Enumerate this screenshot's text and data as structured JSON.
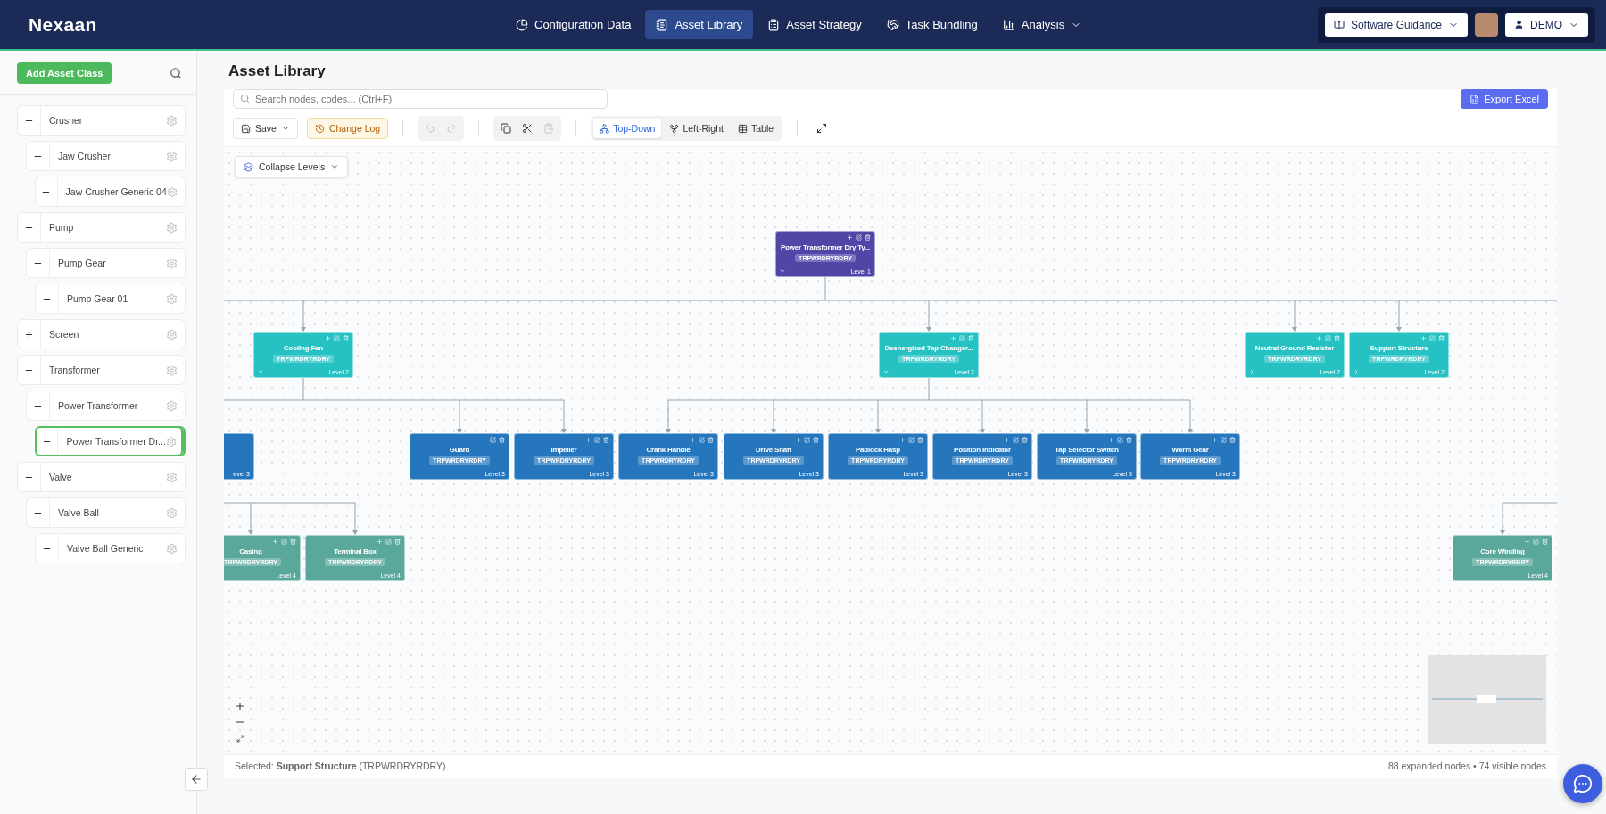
{
  "header": {
    "logo": "Nexaan",
    "nav": [
      {
        "label": "Configuration Data",
        "selected": false
      },
      {
        "label": "Asset Library",
        "selected": true
      },
      {
        "label": "Asset Strategy",
        "selected": false
      },
      {
        "label": "Task Bundling",
        "selected": false
      },
      {
        "label": "Analysis",
        "selected": false,
        "dropdown": true
      }
    ],
    "guidance": "Software Guidance",
    "user": "DEMO"
  },
  "sidebar": {
    "add_button": "Add Asset Class",
    "tree": [
      {
        "label": "Crusher",
        "expanded": true,
        "selected": false,
        "children": [
          {
            "label": "Jaw Crusher",
            "expanded": true,
            "selected": false,
            "children": [
              {
                "label": "Jaw Crusher Generic 04",
                "expanded": true,
                "selected": false
              }
            ]
          }
        ]
      },
      {
        "label": "Pump",
        "expanded": true,
        "selected": false,
        "children": [
          {
            "label": "Pump Gear",
            "expanded": true,
            "selected": false,
            "children": [
              {
                "label": "Pump Gear 01",
                "expanded": true,
                "selected": false
              }
            ]
          }
        ]
      },
      {
        "label": "Screen",
        "expanded": false,
        "selected": false
      },
      {
        "label": "Transformer",
        "expanded": true,
        "selected": false,
        "children": [
          {
            "label": "Power Transformer",
            "expanded": true,
            "selected": false,
            "children": [
              {
                "label": "Power Transformer Dr...",
                "expanded": true,
                "selected": true
              }
            ]
          }
        ]
      },
      {
        "label": "Valve",
        "expanded": true,
        "selected": false,
        "children": [
          {
            "label": "Valve Ball",
            "expanded": true,
            "selected": false,
            "children": [
              {
                "label": "Valve Ball Generic",
                "expanded": true,
                "selected": false
              }
            ]
          }
        ]
      }
    ]
  },
  "page_title": "Asset Library",
  "search": {
    "placeholder": "Search nodes, codes... (Ctrl+F)"
  },
  "export_button": "Export Excel",
  "toolbar": {
    "save": "Save",
    "change_log": "Change Log",
    "undo_disabled": true,
    "redo_disabled": true,
    "paste_disabled": true,
    "views": [
      {
        "label": "Top-Down",
        "selected": true
      },
      {
        "label": "Left-Right",
        "selected": false
      },
      {
        "label": "Table",
        "selected": false
      }
    ]
  },
  "collapse_levels": "Collapse Levels",
  "nodes": [
    {
      "kind": "card",
      "title": "Power Transformer Dry Ty...",
      "code": "TRPWRDRYRDRY",
      "level_label": "Level 1",
      "color": "#5046a6",
      "expanded": true
    },
    {
      "kind": "card",
      "title": "Cooling Fan",
      "code": "TRPWRDRYRDRY",
      "level_label": "Level 2",
      "color": "#26c1c3",
      "expanded": true
    },
    {
      "kind": "card",
      "title": "Deenergized Tap Changer...",
      "code": "TRPWRDRYRDRY",
      "level_label": "Level 2",
      "color": "#26c1c3",
      "expanded": true
    },
    {
      "kind": "card",
      "title": "Neutral Ground Resistor",
      "code": "TRPWRDRYRDRY",
      "level_label": "Level 2",
      "color": "#26c1c3",
      "expanded": false
    },
    {
      "kind": "card",
      "title": "Support Structure",
      "code": "TRPWRDRYRDRY",
      "level_label": "Level 2",
      "color": "#26c1c3",
      "expanded": false
    },
    {
      "kind": "stub",
      "level_label": "evel 3",
      "color": "#2576bd"
    },
    {
      "kind": "card",
      "title": "Guard",
      "code": "TRPWRDRYRDRY",
      "level_label": "Level 3",
      "color": "#2576bd"
    },
    {
      "kind": "card",
      "title": "Impeller",
      "code": "TRPWRDRYRDRY",
      "level_label": "Level 3",
      "color": "#2576bd"
    },
    {
      "kind": "card",
      "title": "Crank Handle",
      "code": "TRPWRDRYRDRY",
      "level_label": "Level 3",
      "color": "#2576bd"
    },
    {
      "kind": "card",
      "title": "Drive Shaft",
      "code": "TRPWRDRYRDRY",
      "level_label": "Level 3",
      "color": "#2576bd"
    },
    {
      "kind": "card",
      "title": "Padlock Hasp",
      "code": "TRPWRDRYRDRY",
      "level_label": "Level 3",
      "color": "#2576bd"
    },
    {
      "kind": "card",
      "title": "Position Indicator",
      "code": "TRPWRDRYRDRY",
      "level_label": "Level 3",
      "color": "#2576bd"
    },
    {
      "kind": "card",
      "title": "Tap Selector Switch",
      "code": "TRPWRDRYRDRY",
      "level_label": "Level 3",
      "color": "#2576bd"
    },
    {
      "kind": "card",
      "title": "Worm Gear",
      "code": "TRPWRDRYRDRY",
      "level_label": "Level 3",
      "color": "#2576bd"
    },
    {
      "kind": "card",
      "title": "Casing",
      "code": "TRPWRDRYRDRY",
      "level_label": "Level 4",
      "color": "#5aa89b"
    },
    {
      "kind": "card",
      "title": "Terminal Box",
      "code": "TRPWRDRYRDRY",
      "level_label": "Level 4",
      "color": "#5aa89b"
    },
    {
      "kind": "card",
      "title": "Core Winding",
      "code": "TRPWRDRYRDRY",
      "level_label": "Level 4",
      "color": "#5aa89b"
    }
  ],
  "status": {
    "selected": "Selected: **Support Structure** (TRPWRDRYRDRY)",
    "counts": "88 expanded nodes • 74 visible nodes"
  }
}
